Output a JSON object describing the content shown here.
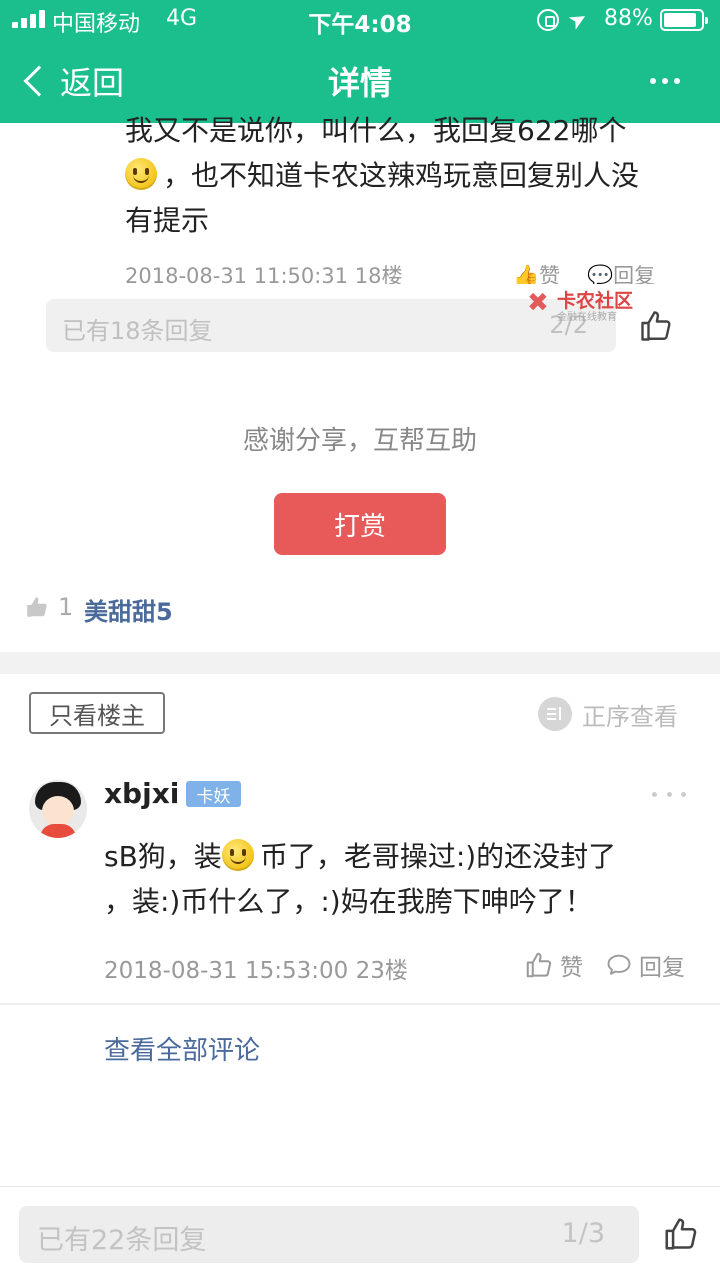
{
  "status_bar": {
    "carrier": "中国移动",
    "network": "4G",
    "time": "下午4:08",
    "battery_pct": "88%",
    "battery_level": 0.88,
    "icons": [
      "signal-icon",
      "orientation-lock-icon",
      "location-icon",
      "battery-icon"
    ]
  },
  "nav": {
    "back_label": "返回",
    "title": "详情",
    "more_icon": "more-icon"
  },
  "colors": {
    "brand_green": "#1bbf8e",
    "reward_red": "#e85a5a",
    "link_blue": "#4a6a9c",
    "badge_blue": "#7fb2e8"
  },
  "quoted_reply": {
    "text_line1": "我又不是说你，叫什么，我回复622哪个",
    "text_line2": "，也不知道卡农这辣鸡玩意回复别人没",
    "text_line3": "有提示",
    "date": "2018-08-31 11:50:31",
    "floor": "18楼",
    "like_label": "赞",
    "reply_label": "回复"
  },
  "reply_box_top": {
    "placeholder": "已有18条回复",
    "page": "2/2"
  },
  "watermark": {
    "title": "卡农社区",
    "subtitle": "金融在线教育"
  },
  "reward": {
    "thanks_text": "感谢分享，互帮互助",
    "button_label": "打赏"
  },
  "likers": {
    "count": "1",
    "names": "美甜甜5"
  },
  "filters": {
    "op_only_label": "只看楼主",
    "order_label": "正序查看"
  },
  "post": {
    "username": "xbjxi",
    "badge": "卡妖",
    "text_line1_a": "sB狗，装",
    "text_line1_b": "币了，老哥操过:)的还没封了",
    "text_line2": "，装:)币什么了，:)妈在我胯下呻吟了！",
    "date": "2018-08-31 15:53:00",
    "floor": "23楼",
    "like_label": "赞",
    "reply_label": "回复"
  },
  "view_all_label": "查看全部评论",
  "bottom_bar": {
    "placeholder": "已有22条回复",
    "page": "1/3"
  }
}
